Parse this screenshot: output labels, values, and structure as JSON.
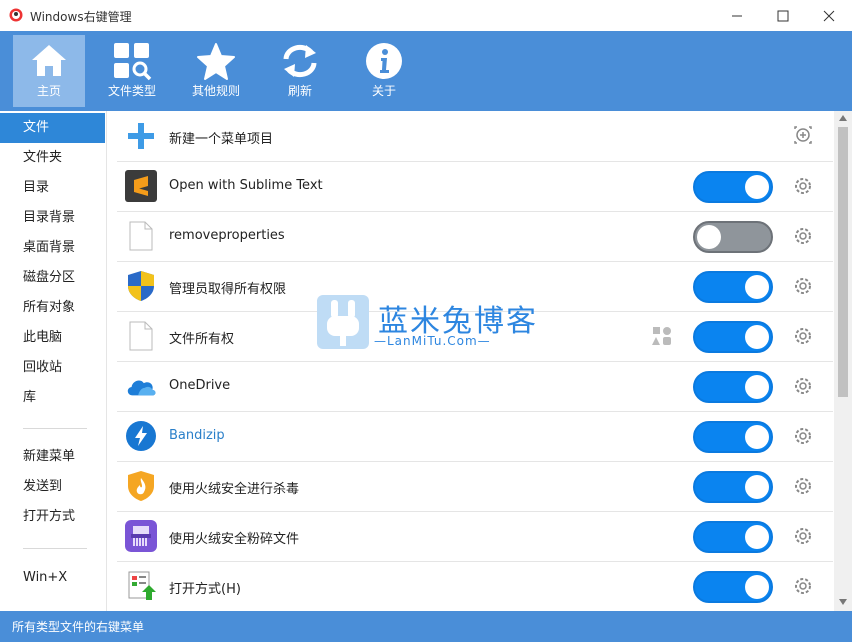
{
  "window": {
    "title": "Windows右键管理"
  },
  "toolbar": {
    "items": [
      {
        "label": "主页",
        "icon": "home-icon",
        "active": true
      },
      {
        "label": "文件类型",
        "icon": "file-type-search-icon"
      },
      {
        "label": "其他规则",
        "icon": "star-icon"
      },
      {
        "label": "刷新",
        "icon": "refresh-icon"
      },
      {
        "label": "关于",
        "icon": "info-icon"
      }
    ]
  },
  "sidebar": {
    "items": [
      "文件",
      "文件夹",
      "目录",
      "目录背景",
      "桌面背景",
      "磁盘分区",
      "所有对象",
      "此电脑",
      "回收站",
      "库"
    ],
    "group2": [
      "新建菜单",
      "发送到",
      "打开方式"
    ],
    "group3": [
      "Win+X"
    ]
  },
  "main": {
    "rows": [
      {
        "label": "新建一个菜单项目",
        "icon": "plus-icon"
      },
      {
        "label": "Open with Sublime Text",
        "icon": "sublime-icon",
        "enabled": true
      },
      {
        "label": "removeproperties",
        "icon": "blank-file-icon",
        "enabled": false
      },
      {
        "label": "管理员取得所有权限",
        "icon": "uac-shield-icon",
        "enabled": true
      },
      {
        "label": "文件所有权",
        "icon": "blank-file-icon",
        "enabled": true
      },
      {
        "label": "OneDrive",
        "icon": "onedrive-cloud-icon",
        "enabled": true
      },
      {
        "label": "Bandizip",
        "icon": "bandizip-icon",
        "enabled": true
      },
      {
        "label": "使用火绒安全进行杀毒",
        "icon": "huorong-shield-icon",
        "enabled": true
      },
      {
        "label": "使用火绒安全粉碎文件",
        "icon": "huorong-shredder-icon",
        "enabled": true
      },
      {
        "label": "打开方式(H)",
        "icon": "open-with-icon",
        "enabled": true
      }
    ]
  },
  "watermark": {
    "title": "蓝米兔博客",
    "subtitle": "—LanMiTu.Com—"
  },
  "status": {
    "text": "所有类型文件的右键菜单"
  },
  "colors": {
    "accent": "#4a8ed8",
    "toggle_on": "#0a84f0",
    "toggle_off": "#8f959b",
    "sidebar_active": "#2e87d8"
  }
}
